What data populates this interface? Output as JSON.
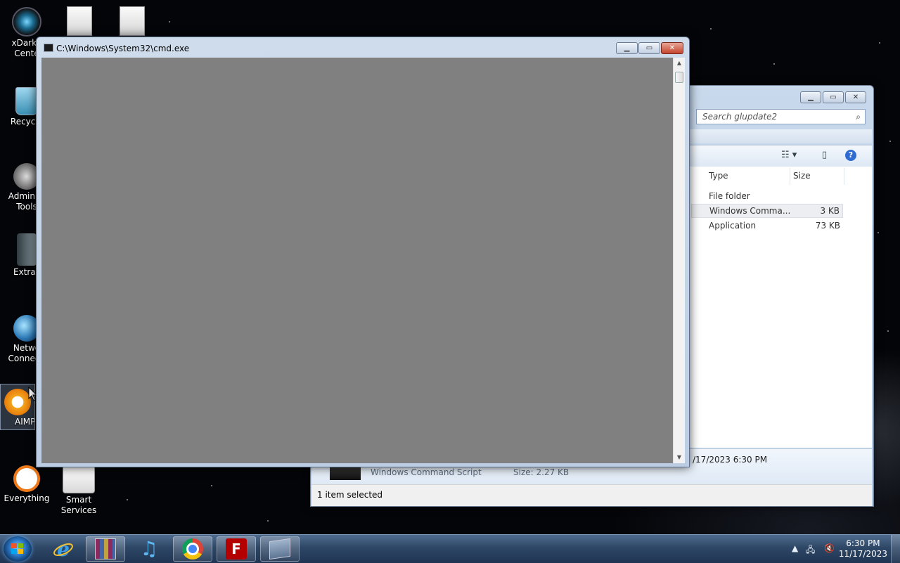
{
  "desktop": {
    "icons": [
      {
        "label": "xDarkT\nCente",
        "glyph": "xdark-icon"
      },
      {
        "label": "Recycle",
        "glyph": "recycle-bin-icon"
      },
      {
        "label": "Administ\nTools",
        "glyph": "admin-tools-icon"
      },
      {
        "label": "Extras",
        "glyph": "folder-icon"
      },
      {
        "label": "Netwo\nConnecti",
        "glyph": "network-icon"
      },
      {
        "label": "AIMP",
        "glyph": "aimp-icon"
      },
      {
        "label": "Everything",
        "glyph": "everything-icon"
      },
      {
        "label": "Smart\nServices",
        "glyph": "smart-services-icon"
      }
    ]
  },
  "cmd_window": {
    "title": "C:\\Windows\\System32\\cmd.exe"
  },
  "explorer_window": {
    "search_placeholder": "Search glupdate2",
    "columns": {
      "type": "Type",
      "size": "Size"
    },
    "rows": [
      {
        "type": "File folder",
        "size": ""
      },
      {
        "type": "Windows Comma...",
        "size": "3 KB"
      },
      {
        "type": "Application",
        "size": "73 KB"
      }
    ],
    "details": {
      "date": "/17/2023 6:30 PM",
      "file_type": "Windows Command Script",
      "size": "Size: 2.27 KB"
    },
    "status": "1 item selected"
  },
  "taskbar": {
    "apps": [
      "internet-explorer-icon",
      "winrar-icon",
      "itunes-icon",
      "chrome-icon",
      "filezilla-icon",
      "cmd-taskbar-icon"
    ],
    "clock_time": "6:30 PM",
    "clock_date": "11/17/2023"
  },
  "colors": {
    "cmd_client": "#808080",
    "taskbar": "#2e4766"
  }
}
